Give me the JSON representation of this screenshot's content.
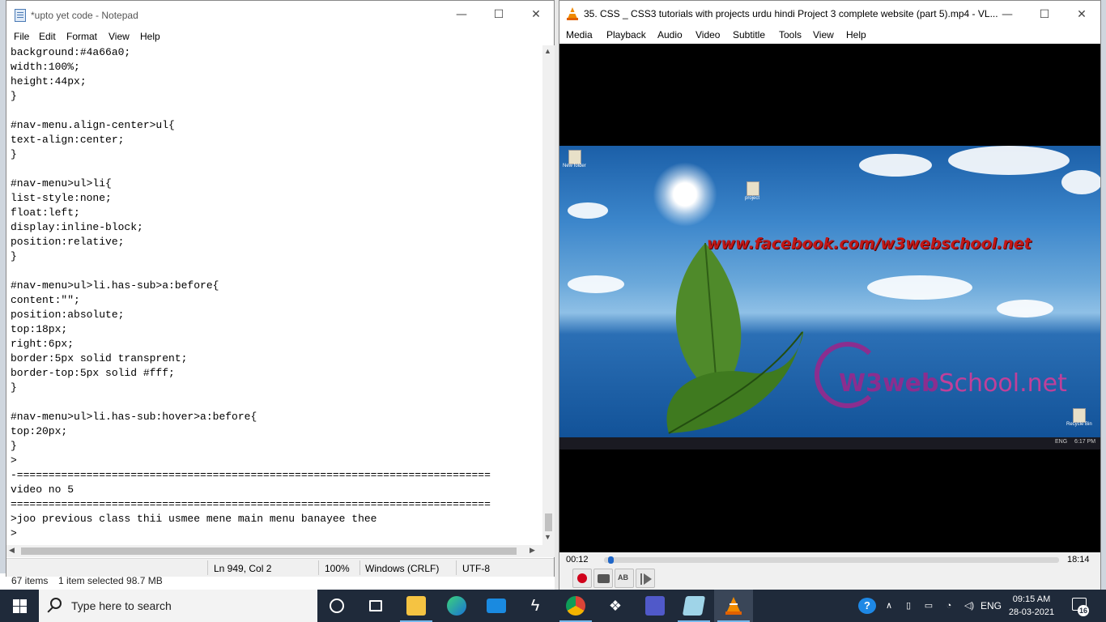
{
  "explorer": {
    "item_count": "67 items",
    "selection": "1 item selected  98.7 MB"
  },
  "notepad": {
    "title": "*upto yet code - Notepad",
    "menu": [
      "File",
      "Edit",
      "Format",
      "View",
      "Help"
    ],
    "lines": [
      "background:#4a66a0;",
      "width:100%;",
      "height:44px;",
      "}",
      "",
      "#nav-menu.align-center>ul{",
      "text-align:center;",
      "}",
      "",
      "#nav-menu>ul>li{",
      "list-style:none;",
      "float:left;",
      "display:inline-block;",
      "position:relative;",
      "}",
      "",
      "#nav-menu>ul>li.has-sub>a:before{",
      "content:\"\";",
      "position:absolute;",
      "top:18px;",
      "right:6px;",
      "border:5px solid transprent;",
      "border-top:5px solid #fff;",
      "}",
      "",
      "#nav-menu>ul>li.has-sub:hover>a:before{",
      "top:20px;",
      "}",
      ">",
      "-===========================================================================",
      "video no 5",
      "============================================================================",
      ">joo previous class thii usmee mene main menu banayee thee",
      ">"
    ],
    "status": {
      "position": "Ln 949, Col 2",
      "zoom": "100%",
      "line_ending": "Windows (CRLF)",
      "encoding": "UTF-8"
    }
  },
  "vlc": {
    "title": "35. CSS _ CSS3 tutorials with projects urdu hindi Project 3 complete website (part 5).mp4 - VL...",
    "menu": [
      "Media",
      "Playback",
      "Audio",
      "Video",
      "Subtitle",
      "Tools",
      "View",
      "Help"
    ],
    "video": {
      "facebook_url": "www.facebook.com/w3webschool.net",
      "logo_w3": "W3",
      "logo_web": "web",
      "logo_school": "School.net",
      "desktop_icons": [
        "New folder",
        "project",
        "Recycle Bin"
      ],
      "inner_clock": "6:17 PM",
      "inner_lang": "ENG"
    },
    "elapsed": "00:12",
    "total": "18:14",
    "progress": 0.011
  },
  "taskbar": {
    "search_placeholder": "Type here to search",
    "language": "ENG",
    "time": "09:15 AM",
    "date": "28-03-2021",
    "notification_count": "16"
  }
}
